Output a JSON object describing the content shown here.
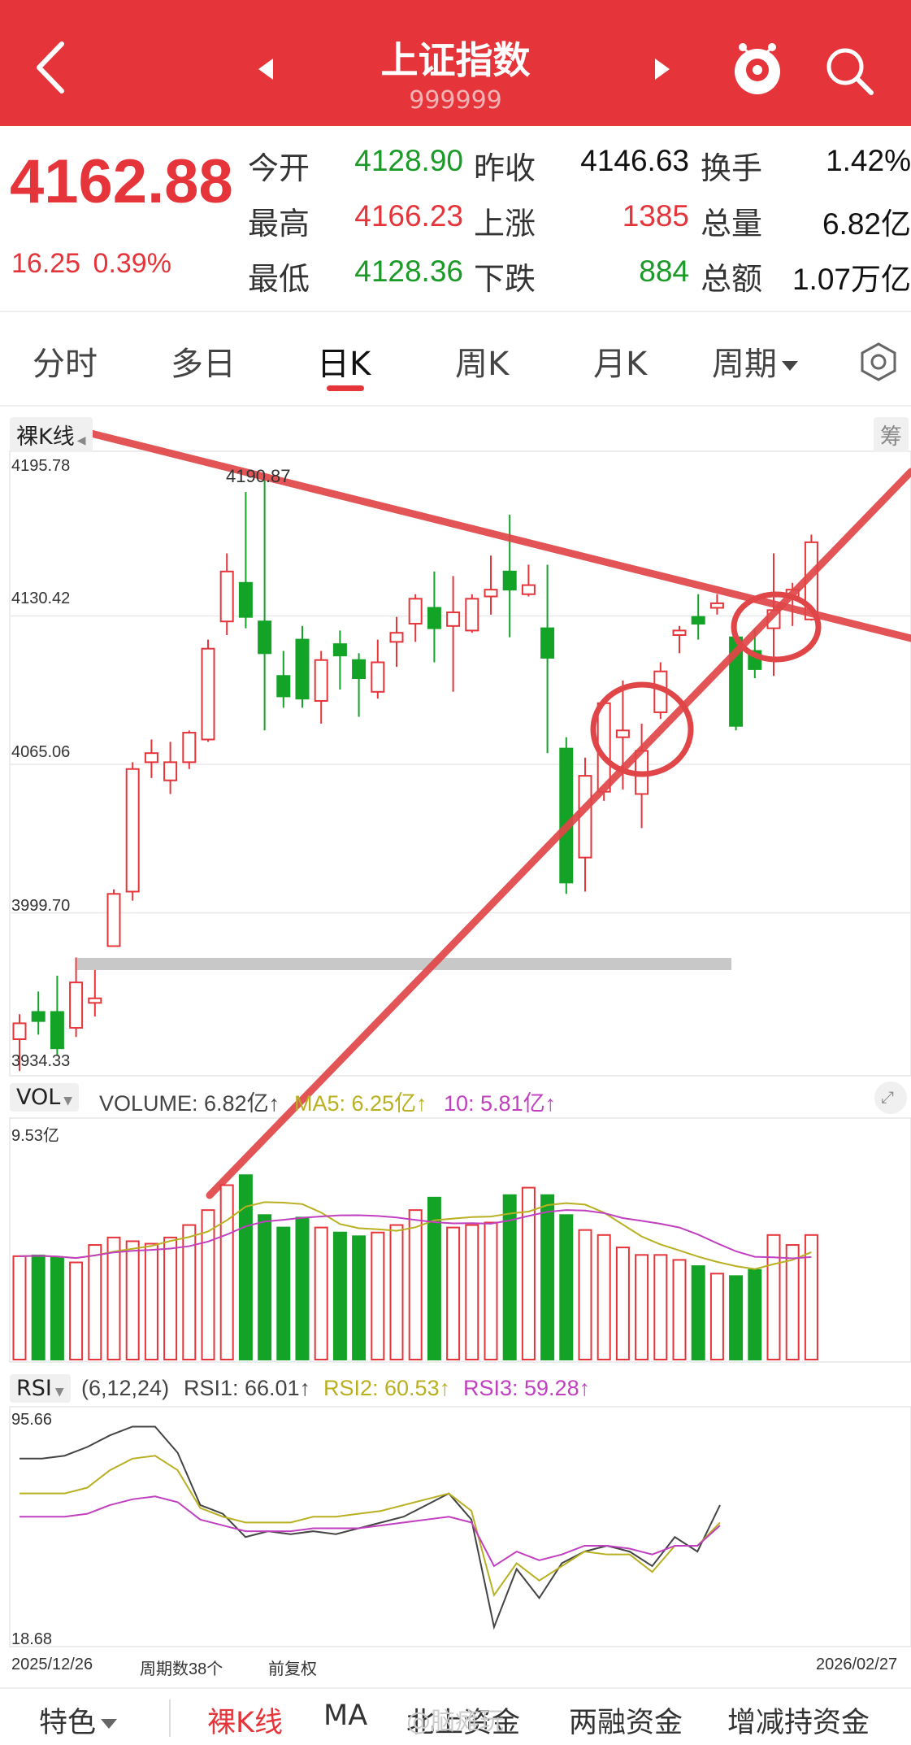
{
  "header": {
    "title": "上证指数",
    "code": "999999"
  },
  "quote": {
    "price": "4162.88",
    "change": "16.25",
    "change_pct": "0.39%",
    "rows": [
      [
        {
          "label": "今开",
          "value": "4128.90",
          "color": "green"
        },
        {
          "label": "昨收",
          "value": "4146.63",
          "color": "black"
        },
        {
          "label": "换手",
          "value": "1.42%",
          "color": "black"
        }
      ],
      [
        {
          "label": "最高",
          "value": "4166.23",
          "color": "red"
        },
        {
          "label": "上涨",
          "value": "1385",
          "color": "red"
        },
        {
          "label": "总量",
          "value": "6.82亿",
          "color": "black"
        }
      ],
      [
        {
          "label": "最低",
          "value": "4128.36",
          "color": "green"
        },
        {
          "label": "下跌",
          "value": "884",
          "color": "green"
        },
        {
          "label": "总额",
          "value": "1.07万亿",
          "color": "black"
        }
      ]
    ]
  },
  "tabs": [
    "分时",
    "多日",
    "日K",
    "周K",
    "月K",
    "周期"
  ],
  "kline": {
    "mode_label": "裸K线",
    "side_button": "筹",
    "axis": [
      "4195.78",
      "4130.42",
      "4065.06",
      "3999.70",
      "3934.33"
    ],
    "high_annotation": "4190.87"
  },
  "volume": {
    "label": "VOL",
    "volume_text": "VOLUME: 6.82亿↑",
    "ma5_text": "MA5: 6.25亿↑",
    "ma10_text": "10: 5.81亿↑",
    "axis_max": "9.53亿"
  },
  "rsi": {
    "label": "RSI",
    "params": "(6,12,24)",
    "rsi1_text": "RSI1: 66.01↑",
    "rsi2_text": "RSI2: 60.53↑",
    "rsi3_text": "RSI3: 59.28↑",
    "axis_max": "95.66",
    "axis_min": "18.68"
  },
  "footer_info": {
    "start_date": "2025/12/26",
    "period_count": "周期数38个",
    "adjust": "前复权",
    "end_date": "2026/02/27"
  },
  "bottom_tabs": [
    "特色",
    "裸K线",
    "MA",
    "北上资金",
    "两融资金",
    "增减持资金"
  ],
  "watermark": "@脑瘫玩",
  "colors": {
    "up": "#e5353b",
    "down": "#13a326",
    "ma5": "#b8b020",
    "ma10": "#c040c0",
    "brand": "#e5353b"
  },
  "chart_data": {
    "type": "candlestick",
    "title": "上证指数 日K",
    "ylim": [
      3934.33,
      4195.78
    ],
    "candles": [
      [
        3944,
        3951,
        3930,
        3955
      ],
      [
        3956,
        3952,
        3946,
        3965
      ],
      [
        3956,
        3940,
        3937,
        3972
      ],
      [
        3949,
        3969,
        3945,
        3980
      ],
      [
        3960,
        3962,
        3954,
        3975
      ],
      [
        3985,
        4008,
        3985,
        4010
      ],
      [
        4009,
        4063,
        4005,
        4066
      ],
      [
        4066,
        4070,
        4059,
        4076
      ],
      [
        4058,
        4066,
        4052,
        4075
      ],
      [
        4066,
        4079,
        4063,
        4080
      ],
      [
        4076,
        4116,
        4075,
        4120
      ],
      [
        4128,
        4150,
        4122,
        4158
      ],
      [
        4145,
        4130,
        4125,
        4185
      ],
      [
        4128,
        4114,
        4080,
        4190.87
      ],
      [
        4104,
        4095,
        4090,
        4115
      ],
      [
        4120,
        4094,
        4090,
        4126
      ],
      [
        4093,
        4111,
        4083,
        4115
      ],
      [
        4118,
        4113,
        4098,
        4124
      ],
      [
        4111,
        4103,
        4086,
        4114
      ],
      [
        4097,
        4110,
        4094,
        4120
      ],
      [
        4119,
        4123,
        4108,
        4130
      ],
      [
        4127,
        4138,
        4119,
        4140
      ],
      [
        4134,
        4125,
        4110,
        4150
      ],
      [
        4126,
        4132,
        4097,
        4148
      ],
      [
        4124,
        4138,
        4123,
        4140
      ],
      [
        4139,
        4142,
        4131,
        4157
      ],
      [
        4150,
        4142,
        4121,
        4175
      ],
      [
        4140,
        4144,
        4139,
        4153
      ],
      [
        4125,
        4112,
        4070,
        4153
      ],
      [
        4072,
        4013,
        4008,
        4077
      ],
      [
        4024,
        4060,
        4009,
        4068
      ],
      [
        4053,
        4092,
        4049,
        4094
      ],
      [
        4077,
        4080,
        4054,
        4102
      ],
      [
        4052,
        4071,
        4037,
        4083
      ],
      [
        4088,
        4106,
        4085,
        4110
      ],
      [
        4122,
        4124,
        4114,
        4126
      ],
      [
        4130,
        4127,
        4120,
        4140
      ],
      [
        4134,
        4136,
        4131,
        4140
      ],
      [
        4121,
        4082,
        4080,
        4131
      ],
      [
        4115,
        4107,
        4103,
        4125
      ],
      [
        4125,
        4133,
        4104,
        4158
      ],
      [
        4139,
        4142,
        4126,
        4145
      ],
      [
        4128.9,
        4162.88,
        4128.36,
        4166.23
      ]
    ],
    "volume": [
      4.15,
      4.18,
      4.08,
      3.9,
      4.6,
      4.9,
      4.75,
      4.65,
      4.9,
      5.4,
      6.0,
      7.0,
      7.4,
      5.8,
      5.3,
      5.7,
      5.3,
      5.1,
      4.95,
      5.1,
      5.4,
      6.0,
      6.5,
      5.3,
      5.4,
      5.5,
      6.6,
      6.9,
      6.6,
      5.8,
      5.2,
      5.0,
      4.5,
      4.2,
      4.2,
      4.0,
      3.75,
      3.45,
      3.35,
      3.6,
      5.0,
      4.6,
      5.0
    ],
    "rsi1": [
      82,
      82,
      83,
      86,
      90,
      93,
      93,
      84,
      66,
      63,
      55,
      57,
      56,
      57,
      56,
      58,
      60,
      62,
      66,
      70,
      61,
      24,
      44,
      34,
      46,
      50,
      52,
      50,
      45,
      55,
      50,
      66
    ],
    "rsi2": [
      70,
      70,
      70,
      72,
      78,
      82,
      83,
      78,
      65,
      62,
      60,
      60,
      60,
      62,
      62,
      63,
      64,
      66,
      68,
      70,
      64,
      35,
      46,
      40,
      45,
      50,
      49,
      49,
      43,
      52,
      52,
      60
    ],
    "rsi3": [
      62,
      62,
      62,
      63,
      66,
      68,
      69,
      67,
      61,
      59,
      57,
      57,
      57,
      58,
      58,
      58,
      59,
      60,
      61,
      62,
      60,
      45,
      50,
      47,
      49,
      52,
      52,
      51,
      49,
      52,
      52,
      59
    ]
  }
}
